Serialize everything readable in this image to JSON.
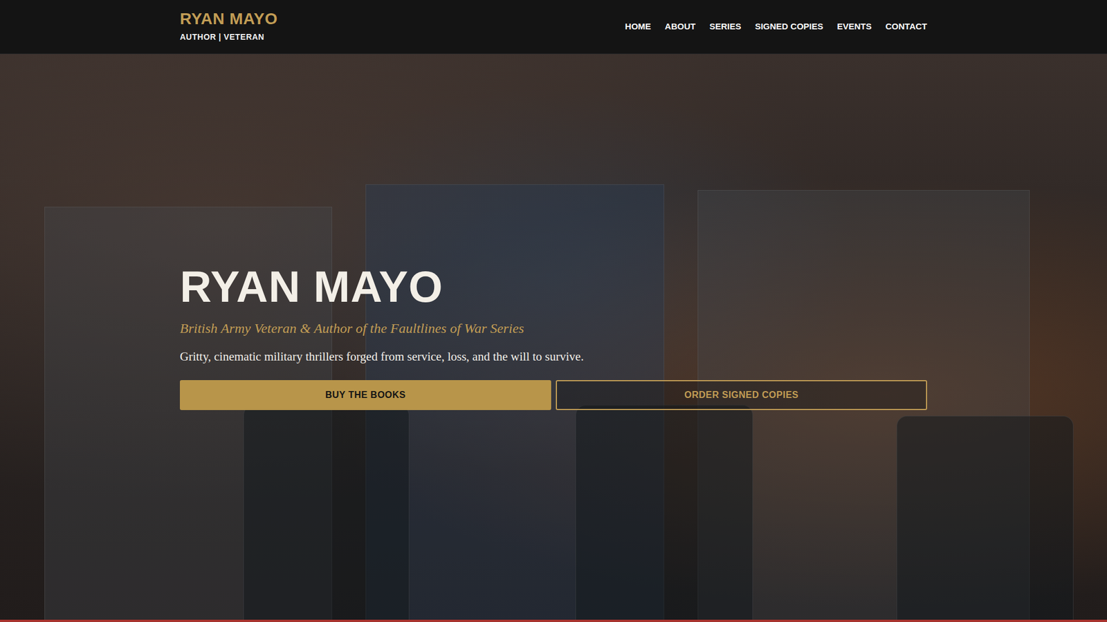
{
  "brand": {
    "name": "RYAN MAYO",
    "tagline": "AUTHOR | VETERAN"
  },
  "nav": [
    {
      "label": "HOME"
    },
    {
      "label": "ABOUT"
    },
    {
      "label": "SERIES"
    },
    {
      "label": "SIGNED COPIES"
    },
    {
      "label": "EVENTS"
    },
    {
      "label": "CONTACT"
    }
  ],
  "hero": {
    "title": "RYAN MAYO",
    "subtitle": "British Army Veteran & Author of the Faultlines of War Series",
    "text": "Gritty, cinematic military thrillers forged from service, loss, and the will to survive.",
    "buttons": [
      {
        "label": "BUY THE BOOKS",
        "kind": "primary"
      },
      {
        "label": "ORDER SIGNED COPIES",
        "kind": "outline"
      }
    ]
  }
}
